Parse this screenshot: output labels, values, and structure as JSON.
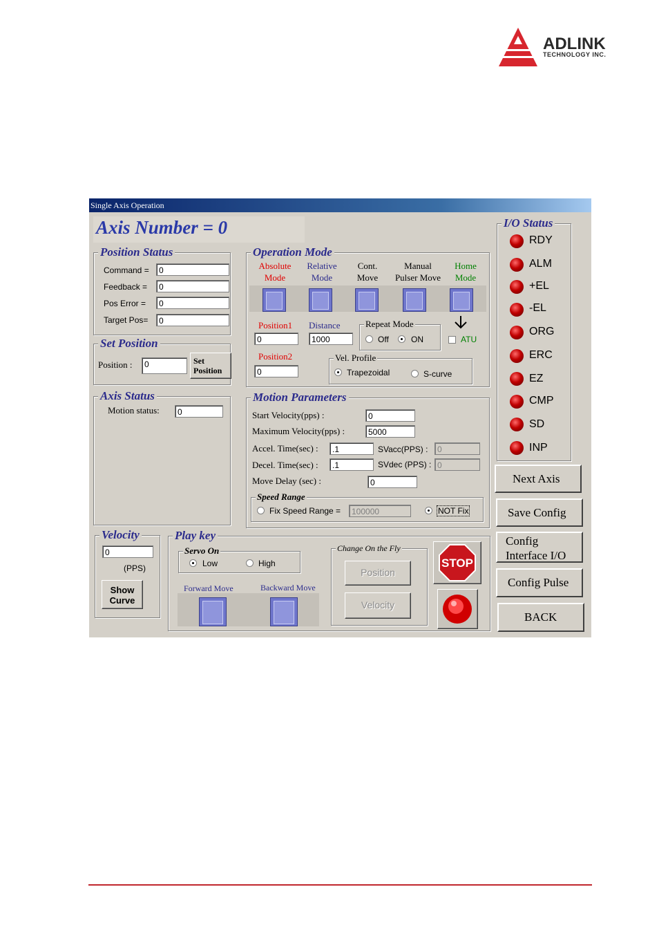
{
  "brand": {
    "name": "ADLINK",
    "tagline": "TECHNOLOGY INC."
  },
  "window": {
    "title": "Single Axis Operation"
  },
  "axis_number": "Axis Number =  0",
  "position_status": {
    "title": "Position Status",
    "rows": [
      {
        "label": "Command =",
        "value": "0"
      },
      {
        "label": "Feedback =",
        "value": "0"
      },
      {
        "label": "Pos Error =",
        "value": "0"
      },
      {
        "label": "Target Pos=",
        "value": "0"
      }
    ]
  },
  "set_position": {
    "title": "Set Position",
    "label": "Position :",
    "value": "0",
    "button_line1": "Set",
    "button_line2": "Position"
  },
  "axis_status": {
    "title": "Axis Status",
    "label": "Motion status:",
    "value": "0"
  },
  "operation_mode": {
    "title": "Operation Mode",
    "modes": [
      {
        "line1": "Absolute",
        "line2": "Mode",
        "color": "#e00000"
      },
      {
        "line1": "Relative",
        "line2": "Mode",
        "color": "#2b2b8c"
      },
      {
        "line1": "Cont.",
        "line2": "Move",
        "color": "#000000"
      },
      {
        "line1": "Manual",
        "line2": "Pulser Move",
        "color": "#000000"
      },
      {
        "line1": "Home",
        "line2": "Mode",
        "color": "#008000"
      }
    ],
    "position1_label": "Position1",
    "position1_value": "0",
    "distance_label": "Distance",
    "distance_value": "1000",
    "position2_label": "Position2",
    "position2_value": "0",
    "repeat_mode": {
      "title": "Repeat Mode",
      "off": "Off",
      "on": "ON"
    },
    "atu_label": "ATU",
    "vel_profile": {
      "title": "Vel. Profile",
      "trap": "Trapezoidal",
      "scurve": "S-curve"
    }
  },
  "motion_parameters": {
    "title": "Motion Parameters",
    "start_velocity_label": "Start Velocity(pps) :",
    "start_velocity": "0",
    "max_velocity_label": "Maximum  Velocity(pps) :",
    "max_velocity": "5000",
    "accel_label": "Accel. Time(sec) :",
    "accel": ".1",
    "svacc_label": "SVacc(PPS) :",
    "svacc": "0",
    "decel_label": "Decel. Time(sec) :",
    "decel": ".1",
    "svdec_label": "SVdec (PPS) :",
    "svdec": "0",
    "delay_label": "Move Delay (sec) :",
    "delay": "0",
    "speed_range": {
      "title": "Speed Range",
      "fix_label": "Fix Speed Range =",
      "fix_value": "100000",
      "notfix_label": "NOT Fix"
    }
  },
  "io_status": {
    "title": "I/O Status",
    "items": [
      "RDY",
      "ALM",
      "+EL",
      "-EL",
      "ORG",
      "ERC",
      "EZ",
      "CMP",
      "SD",
      "INP"
    ],
    "led_color": "#c00000"
  },
  "side_buttons": {
    "next_axis": "Next Axis",
    "save_config": "Save Config",
    "config_interface_1": "Config",
    "config_interface_2": "Interface I/O",
    "config_pulse": "Config Pulse",
    "back": "BACK"
  },
  "velocity": {
    "title": "Velocity",
    "value": "0",
    "unit": "(PPS)",
    "show_curve_1": "Show",
    "show_curve_2": "Curve"
  },
  "play_key": {
    "title": "Play key",
    "servo_on": {
      "title": "Servo On",
      "low": "Low",
      "high": "High"
    },
    "forward_label": "Forward Move",
    "backward_label": "Backward Move",
    "change_on_fly": {
      "title": "Change On the Fly",
      "position": "Position",
      "velocity": "Velocity"
    },
    "stop_label": "STOP"
  }
}
